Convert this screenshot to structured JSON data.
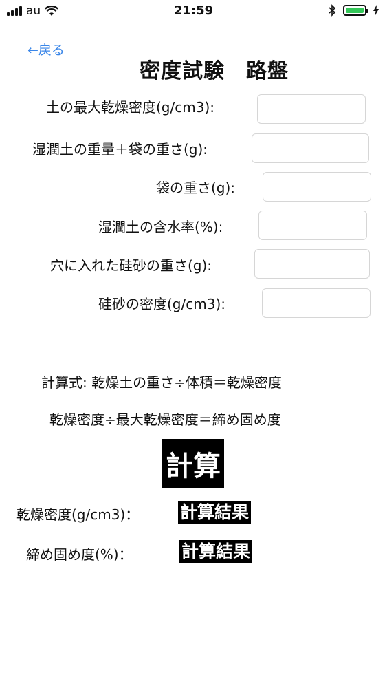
{
  "status_bar": {
    "carrier": "au",
    "time": "21:59"
  },
  "nav": {
    "back_label": "←戻る"
  },
  "title": "密度試験　路盤",
  "fields": [
    {
      "label": "土の最大乾燥密度(g/cm3):",
      "value": "",
      "placeholder": ""
    },
    {
      "label": "湿潤土の重量＋袋の重さ(g):",
      "value": "",
      "placeholder": ""
    },
    {
      "label": "袋の重さ(g):",
      "value": "",
      "placeholder": ""
    },
    {
      "label": "湿潤土の含水率(%):",
      "value": "",
      "placeholder": ""
    },
    {
      "label": "穴に入れた硅砂の重さ(g):",
      "value": "",
      "placeholder": ""
    },
    {
      "label": "硅砂の密度(g/cm3):",
      "value": "",
      "placeholder": ""
    }
  ],
  "formula": {
    "line1": "計算式: 乾燥土の重さ÷体積＝乾燥密度",
    "line2": "乾燥密度÷最大乾燥密度＝締め固め度"
  },
  "calculate_button": "計算",
  "results": [
    {
      "label": "乾燥密度(g/cm3)：",
      "value": "計算結果"
    },
    {
      "label": "締め固め度(%)：",
      "value": "計算結果"
    }
  ],
  "colors": {
    "link": "#3a86e8",
    "battery": "#34c759",
    "input_border": "#d6d6d6"
  }
}
